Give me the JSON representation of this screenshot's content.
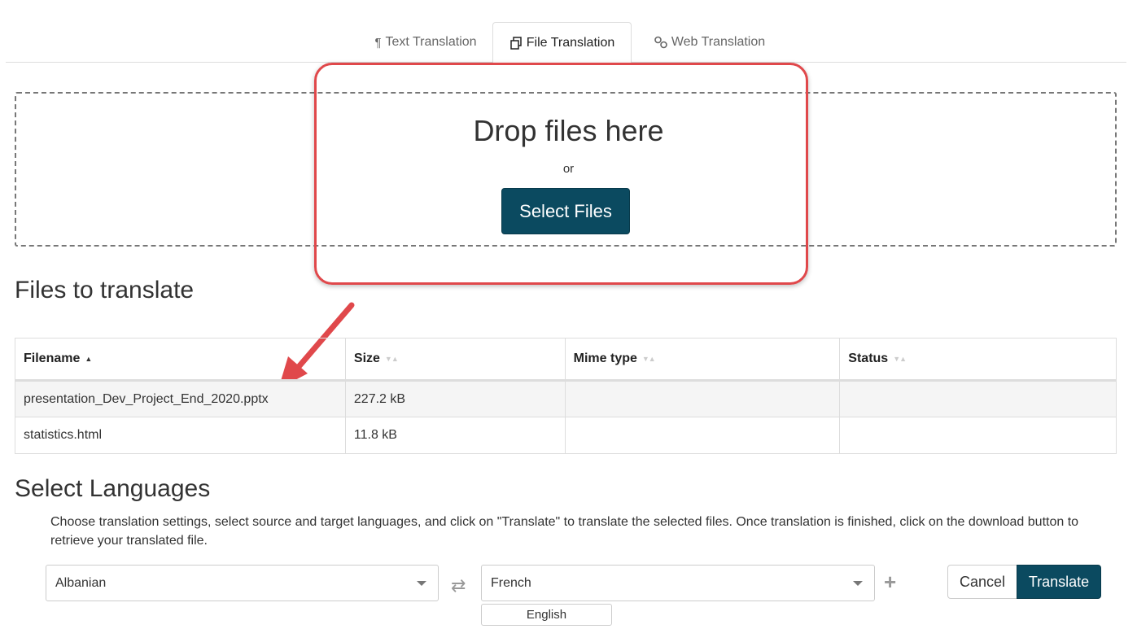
{
  "tabs": [
    {
      "label": "Text Translation",
      "icon": "pilcrow-icon",
      "active": false
    },
    {
      "label": "File Translation",
      "icon": "copy-icon",
      "active": true
    },
    {
      "label": "Web Translation",
      "icon": "link-icon",
      "active": false
    }
  ],
  "dropzone": {
    "title": "Drop files here",
    "or": "or",
    "button": "Select Files"
  },
  "files_section": {
    "heading": "Files to translate",
    "columns": [
      "Filename",
      "Size",
      "Mime type",
      "Status"
    ],
    "sorted_column": "Filename",
    "rows": [
      {
        "filename": "presentation_Dev_Project_End_2020.pptx",
        "size": "227.2 kB",
        "mime": "",
        "status": ""
      },
      {
        "filename": "statistics.html",
        "size": "11.8 kB",
        "mime": "",
        "status": ""
      }
    ]
  },
  "languages_section": {
    "heading": "Select Languages",
    "description": "Choose translation settings, select source and target languages, and click on \"Translate\" to translate the selected files. Once translation is finished, click on the download button to retrieve your translated file.",
    "source": "Albanian",
    "target": "French",
    "extra_target": "English",
    "cancel": "Cancel",
    "translate": "Translate"
  },
  "colors": {
    "primary": "#0b4a60",
    "annotation": "#e0484b",
    "border": "#dddddd"
  }
}
